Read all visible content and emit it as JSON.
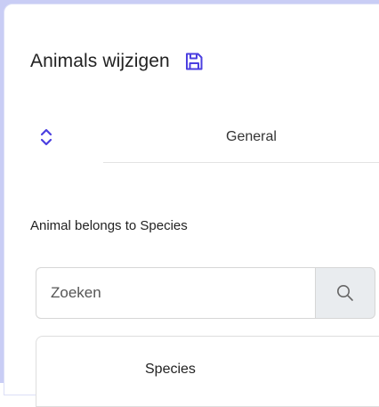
{
  "header": {
    "title": "Animals wijzigen",
    "save_icon": "save-icon"
  },
  "tabs": {
    "sort_icon": "chevron-up-down-icon",
    "items": [
      {
        "label": "General"
      }
    ]
  },
  "relation": {
    "label": "Animal belongs to Species"
  },
  "search": {
    "placeholder": "Zoeken",
    "value": "",
    "button_icon": "search-icon"
  },
  "table": {
    "columns": [
      "Species"
    ]
  },
  "colors": {
    "accent": "#4b3fe0",
    "frame": "#c9cdf5",
    "search_button_bg": "#e9ecef"
  }
}
